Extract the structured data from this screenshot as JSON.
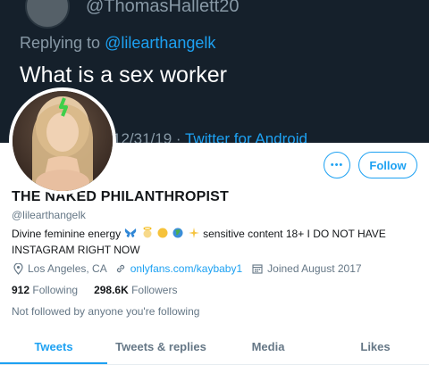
{
  "tweet": {
    "handle": "@ThomasHallett20",
    "replying_prefix": "Replying to ",
    "replying_to": "@lilearthangelk",
    "text": "What is a sex worker",
    "date": "12/31/19 · ",
    "source": "Twitter for Android"
  },
  "profile": {
    "more_label": "•••",
    "follow_label": "Follow",
    "display_name": "THE NAKED PHILANTHROPIST",
    "handle": "@lilearthangelk",
    "bio_start": "Divine feminine energy ",
    "bio_end": " sensitive content 18+ I DO NOT HAVE INSTAGRAM RIGHT NOW",
    "location": "Los Angeles, CA",
    "website": "onlyfans.com/kaybaby1",
    "joined": "Joined August 2017",
    "following_count": "912",
    "following_label": " Following",
    "followers_count": "298.6K",
    "followers_label": " Followers",
    "not_followed": "Not followed by anyone you're following"
  },
  "tabs": [
    {
      "label": "Tweets",
      "active": true
    },
    {
      "label": "Tweets & replies",
      "active": false
    },
    {
      "label": "Media",
      "active": false
    },
    {
      "label": "Likes",
      "active": false
    }
  ],
  "colors": {
    "accent": "#1da1f2",
    "banner_bg": "#15202b",
    "secondary_text": "#657786"
  }
}
